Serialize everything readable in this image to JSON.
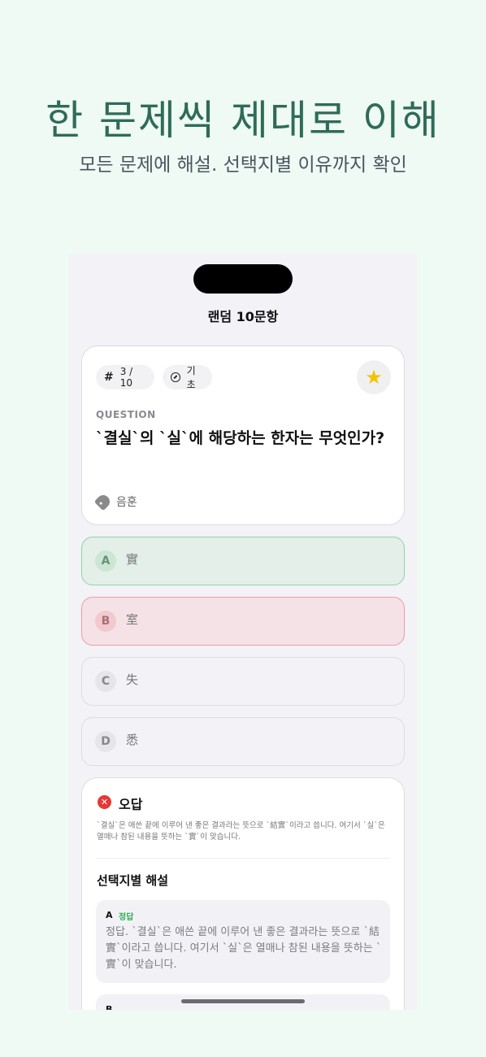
{
  "hero": {
    "title": "한 문제씩 제대로 이해",
    "subtitle": "모든 문제에 해설. 선택지별 이유까지 확인"
  },
  "nav": {
    "title": "랜덤 10문항"
  },
  "question": {
    "number": "3 / 10",
    "level": "기초",
    "label": "QUESTION",
    "text": "`결실`의 `실`에 해당하는 한자는 무엇인가?",
    "tag": "음훈",
    "starred": true
  },
  "options": [
    {
      "letter": "A",
      "text": "實",
      "state": "correct"
    },
    {
      "letter": "B",
      "text": "室",
      "state": "wrong"
    },
    {
      "letter": "C",
      "text": "失",
      "state": "default"
    },
    {
      "letter": "D",
      "text": "悉",
      "state": "default"
    }
  ],
  "explanation": {
    "result": "오답",
    "summary": "`결실`은 애쓴 끝에 이루어 낸 좋은 결과라는 뜻으로 `結實`이라고 씁니다. 여기서 `실`은 열매나 참된 내용을 뜻하는 `實`이 맞습니다.",
    "section_title": "선택지별 해설",
    "choices": [
      {
        "letter": "A",
        "badge": "정답",
        "text": "정답. `결실`은 애쓴 끝에 이루어 낸 좋은 결과라는 뜻으로 `結實`이라고 씁니다. 여기서 `실`은 열매나 참된 내용을 뜻하는 `實`이 맞습니다."
      },
      {
        "letter": "B"
      }
    ]
  },
  "colors": {
    "background": "#eefaf3",
    "hero_title": "#2f6b58",
    "correct": "#2eae55",
    "wrong": "#e53935",
    "star": "#f2c300"
  }
}
